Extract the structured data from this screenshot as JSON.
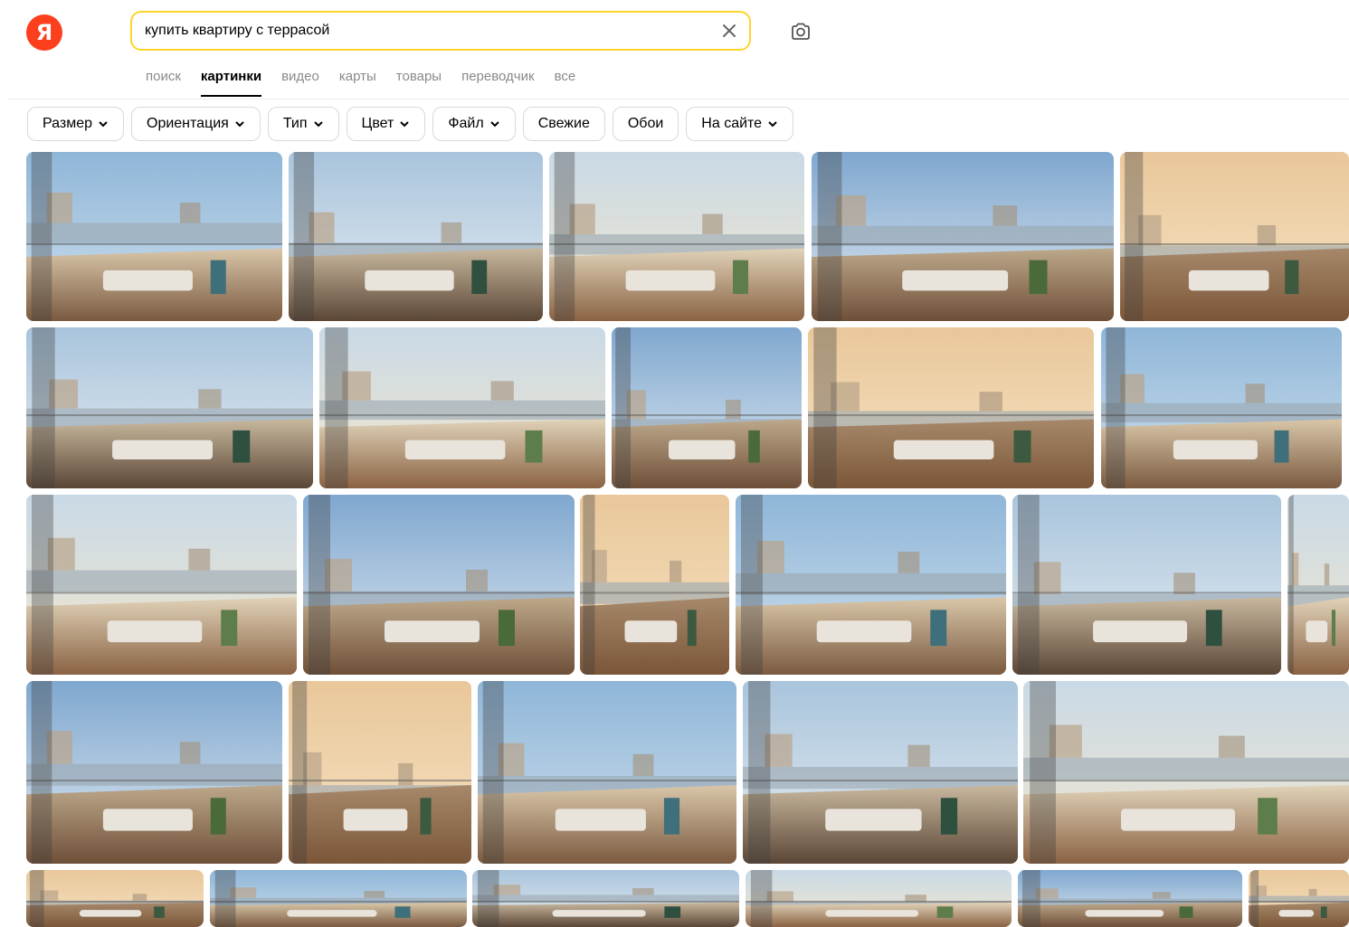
{
  "logo": {
    "letter": "Я",
    "color": "#fc3f1d"
  },
  "search": {
    "query": "купить квартиру с террасой",
    "accent": "#fed42b"
  },
  "icons": {
    "clear": "close-icon",
    "camera": "camera-icon",
    "chevron": "chevron-down-icon"
  },
  "tabs": [
    {
      "label": "поиск",
      "active": false
    },
    {
      "label": "картинки",
      "active": true
    },
    {
      "label": "видео",
      "active": false
    },
    {
      "label": "карты",
      "active": false
    },
    {
      "label": "товары",
      "active": false
    },
    {
      "label": "переводчик",
      "active": false
    },
    {
      "label": "все",
      "active": false
    }
  ],
  "filters": [
    {
      "label": "Размер",
      "dropdown": true
    },
    {
      "label": "Ориентация",
      "dropdown": true
    },
    {
      "label": "Тип",
      "dropdown": true
    },
    {
      "label": "Цвет",
      "dropdown": true
    },
    {
      "label": "Файл",
      "dropdown": true
    },
    {
      "label": "Свежие",
      "dropdown": false
    },
    {
      "label": "Обои",
      "dropdown": false
    },
    {
      "label": "На сайте",
      "dropdown": true
    }
  ]
}
